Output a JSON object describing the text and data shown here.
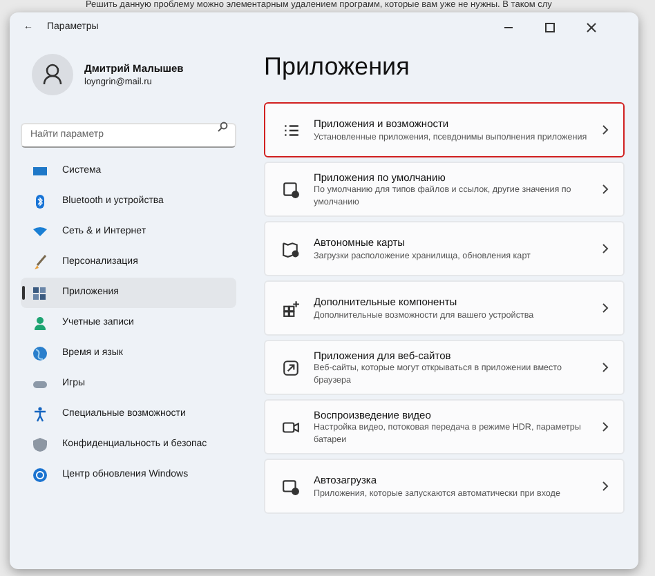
{
  "background_text": "Решить данную проблему можно элементарным удалением программ, которые вам уже не нужны. В таком слу",
  "window": {
    "title": "Параметры",
    "back": "←"
  },
  "user": {
    "name": "Дмитрий Малышев",
    "email": "loyngrin@mail.ru"
  },
  "search": {
    "placeholder": "Найти параметр"
  },
  "sidebar": {
    "items": [
      {
        "label": "Система",
        "selected": false
      },
      {
        "label": "Bluetooth и устройства",
        "selected": false
      },
      {
        "label": "Сеть & и Интернет",
        "selected": false
      },
      {
        "label": "Персонализация",
        "selected": false
      },
      {
        "label": "Приложения",
        "selected": true
      },
      {
        "label": "Учетные записи",
        "selected": false
      },
      {
        "label": "Время и язык",
        "selected": false
      },
      {
        "label": "Игры",
        "selected": false
      },
      {
        "label": "Специальные возможности",
        "selected": false
      },
      {
        "label": "Конфиденциальность и безопас",
        "selected": false
      },
      {
        "label": "Центр обновления Windows",
        "selected": false
      }
    ]
  },
  "page_title": "Приложения",
  "cards": [
    {
      "title": "Приложения и возможности",
      "subtitle": "Установленные приложения, псевдонимы выполнения приложения",
      "highlighted": true
    },
    {
      "title": "Приложения по умолчанию",
      "subtitle": "По умолчанию для типов файлов и ссылок, другие значения по умолчанию",
      "highlighted": false
    },
    {
      "title": "Автономные карты",
      "subtitle": "Загрузки расположение хранилища, обновления карт",
      "highlighted": false
    },
    {
      "title": "Дополнительные компоненты",
      "subtitle": "Дополнительные возможности для вашего устройства",
      "highlighted": false
    },
    {
      "title": "Приложения для веб-сайтов",
      "subtitle": "Веб-сайты, которые могут открываться в приложении вместо браузера",
      "highlighted": false
    },
    {
      "title": "Воспроизведение видео",
      "subtitle": "Настройка видео, потоковая передача в режиме HDR, параметры батареи",
      "highlighted": false
    },
    {
      "title": "Автозагрузка",
      "subtitle": "Приложения, которые запускаются автоматически при входе",
      "highlighted": false
    }
  ]
}
